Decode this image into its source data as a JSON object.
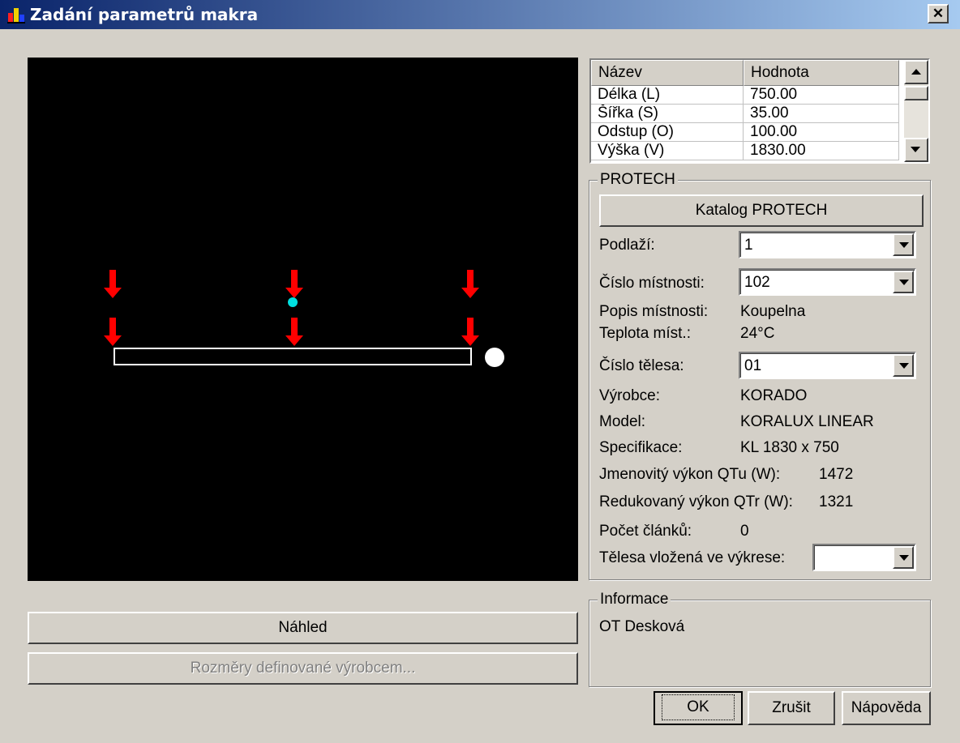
{
  "window": {
    "title": "Zadání parametrů makra",
    "close_label": "✕"
  },
  "grid": {
    "headers": [
      "Název",
      "Hodnota"
    ],
    "rows": [
      {
        "name": "Délka (L)",
        "value": "750.00"
      },
      {
        "name": "Šířka (S)",
        "value": "35.00"
      },
      {
        "name": "Odstup (O)",
        "value": "100.00"
      },
      {
        "name": "Výška (V)",
        "value": "1830.00"
      }
    ]
  },
  "protech": {
    "group_label": "PROTECH",
    "catalog_button": "Katalog PROTECH",
    "floor": {
      "label": "Podlaží:",
      "value": "1"
    },
    "room_number": {
      "label": "Číslo místnosti:",
      "value": "102"
    },
    "room_desc": {
      "label": "Popis místnosti:",
      "value": "Koupelna"
    },
    "room_temp": {
      "label": "Teplota míst.:",
      "value": "24°C"
    },
    "body_number": {
      "label": "Číslo tělesa:",
      "value": "01"
    },
    "manufacturer": {
      "label": "Výrobce:",
      "value": "KORADO"
    },
    "model": {
      "label": "Model:",
      "value": "KORALUX LINEAR"
    },
    "spec": {
      "label": "Specifikace:",
      "value": "KL 1830 x 750"
    },
    "nominal_power": {
      "label": "Jmenovitý výkon QTu (W):",
      "value": "1472"
    },
    "reduced_power": {
      "label": "Redukovaný výkon QTr (W):",
      "value": "1321"
    },
    "sections": {
      "label": "Počet článků:",
      "value": "0"
    },
    "inserted": {
      "label": "Tělesa vložená ve výkrese:",
      "value": ""
    }
  },
  "info": {
    "group_label": "Informace",
    "text": "OT Desková"
  },
  "buttons": {
    "preview": "Náhled",
    "dimensions": "Rozměry definované výrobcem...",
    "ok": "OK",
    "cancel": "Zrušit",
    "help": "Nápověda"
  },
  "colors": {
    "title_start": "#0a246a",
    "title_end": "#a6caf0",
    "arrow": "#ff0000",
    "point": "#00e0e0"
  }
}
